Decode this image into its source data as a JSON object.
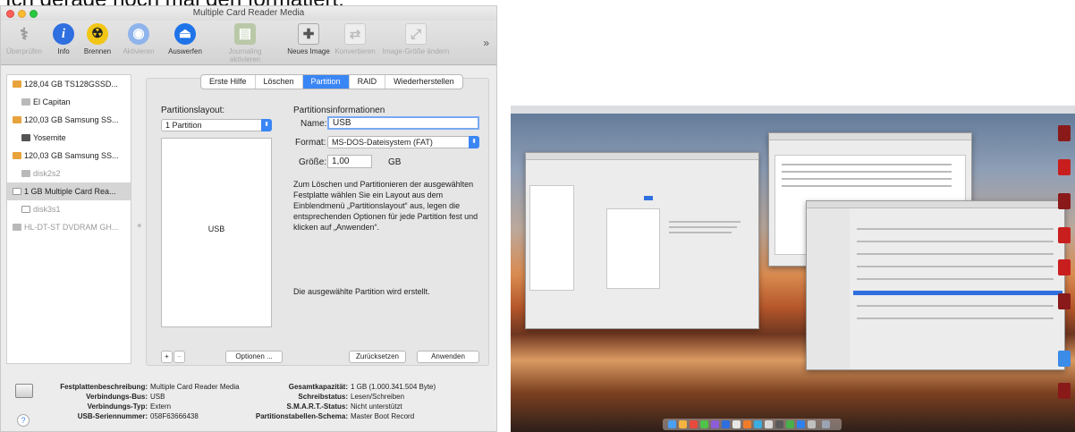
{
  "top_text": "Ich gerade noch mal den formatiert:",
  "window": {
    "title": "Multiple Card Reader Media",
    "colors": {
      "accent": "#3a86f5",
      "window_bg": "#ececec"
    }
  },
  "toolbar": {
    "items": [
      {
        "label": "Überprüfen",
        "icon": "stethoscope-icon",
        "enabled": false
      },
      {
        "label": "Info",
        "icon": "info-icon",
        "enabled": true
      },
      {
        "label": "Brennen",
        "icon": "radiation-icon",
        "enabled": true
      },
      {
        "label": "Aktivieren",
        "icon": "disk-activate-icon",
        "enabled": false
      },
      {
        "label": "Auswerfen",
        "icon": "eject-icon",
        "enabled": true
      },
      {
        "label": "Journaling aktivieren",
        "icon": "journal-icon",
        "enabled": false
      },
      {
        "label": "Neues Image",
        "icon": "new-image-icon",
        "enabled": true
      },
      {
        "label": "Konvertieren",
        "icon": "convert-icon",
        "enabled": false
      },
      {
        "label": "Image-Größe ändern",
        "icon": "resize-image-icon",
        "enabled": false
      }
    ],
    "overflow": "»"
  },
  "sidebar": {
    "items": [
      {
        "label": "128,04 GB TS128GSSD...",
        "level": 1,
        "icon": "orange"
      },
      {
        "label": "El Capitan",
        "level": 2,
        "icon": "gray"
      },
      {
        "label": "120,03 GB Samsung SS...",
        "level": 1,
        "icon": "orange"
      },
      {
        "label": "Yosemite",
        "level": 2,
        "icon": "dark"
      },
      {
        "label": "120,03 GB Samsung SS...",
        "level": 1,
        "icon": "orange"
      },
      {
        "label": "disk2s2",
        "level": 2,
        "icon": "gray",
        "dim": true
      },
      {
        "label": "1 GB Multiple Card Rea...",
        "level": 1,
        "icon": "white",
        "selected": true
      },
      {
        "label": "disk3s1",
        "level": 2,
        "icon": "white",
        "dim": true
      },
      {
        "label": "HL-DT-ST DVDRAM GH...",
        "level": 1,
        "icon": "gray",
        "dim": true
      }
    ]
  },
  "tabs": [
    "Erste Hilfe",
    "Löschen",
    "Partition",
    "RAID",
    "Wiederherstellen"
  ],
  "active_tab": "Partition",
  "partition": {
    "layout_label": "Partitionslayout:",
    "layout_value": "1 Partition",
    "partition_name": "USB",
    "plus": "+",
    "minus": "−",
    "options_button": "Optionen ..."
  },
  "info_panel": {
    "heading": "Partitionsinformationen",
    "name_label": "Name:",
    "name_value": "USB",
    "format_label": "Format:",
    "format_value": "MS-DOS-Dateisystem (FAT)",
    "size_label": "Größe:",
    "size_value": "1,00",
    "size_unit": "GB",
    "description": "Zum Löschen und Partitionieren der ausgewählten Festplatte wählen Sie ein Layout aus dem Einblendmenü „Partitionslayout“ aus, legen die entsprechenden Optionen für jede Partition fest und klicken auf „Anwenden“.",
    "status": "Die ausgewählte Partition wird erstellt.",
    "reset_button": "Zurücksetzen",
    "apply_button": "Anwenden"
  },
  "disk_info": {
    "left": [
      {
        "key": "Festplattenbeschreibung:",
        "value": "Multiple Card Reader Media"
      },
      {
        "key": "Verbindungs-Bus:",
        "value": "USB"
      },
      {
        "key": "Verbindungs-Typ:",
        "value": "Extern"
      },
      {
        "key": "USB-Seriennummer:",
        "value": "058F63666438"
      }
    ],
    "right": [
      {
        "key": "Gesamtkapazität:",
        "value": "1 GB (1.000.341.504 Byte)"
      },
      {
        "key": "Schreibstatus:",
        "value": "Lesen/Schreiben"
      },
      {
        "key": "S.M.A.R.T.-Status:",
        "value": "Nicht unterstützt"
      },
      {
        "key": "Partitionstabellen-Schema:",
        "value": "Master Boot Record"
      }
    ],
    "help": "?"
  }
}
